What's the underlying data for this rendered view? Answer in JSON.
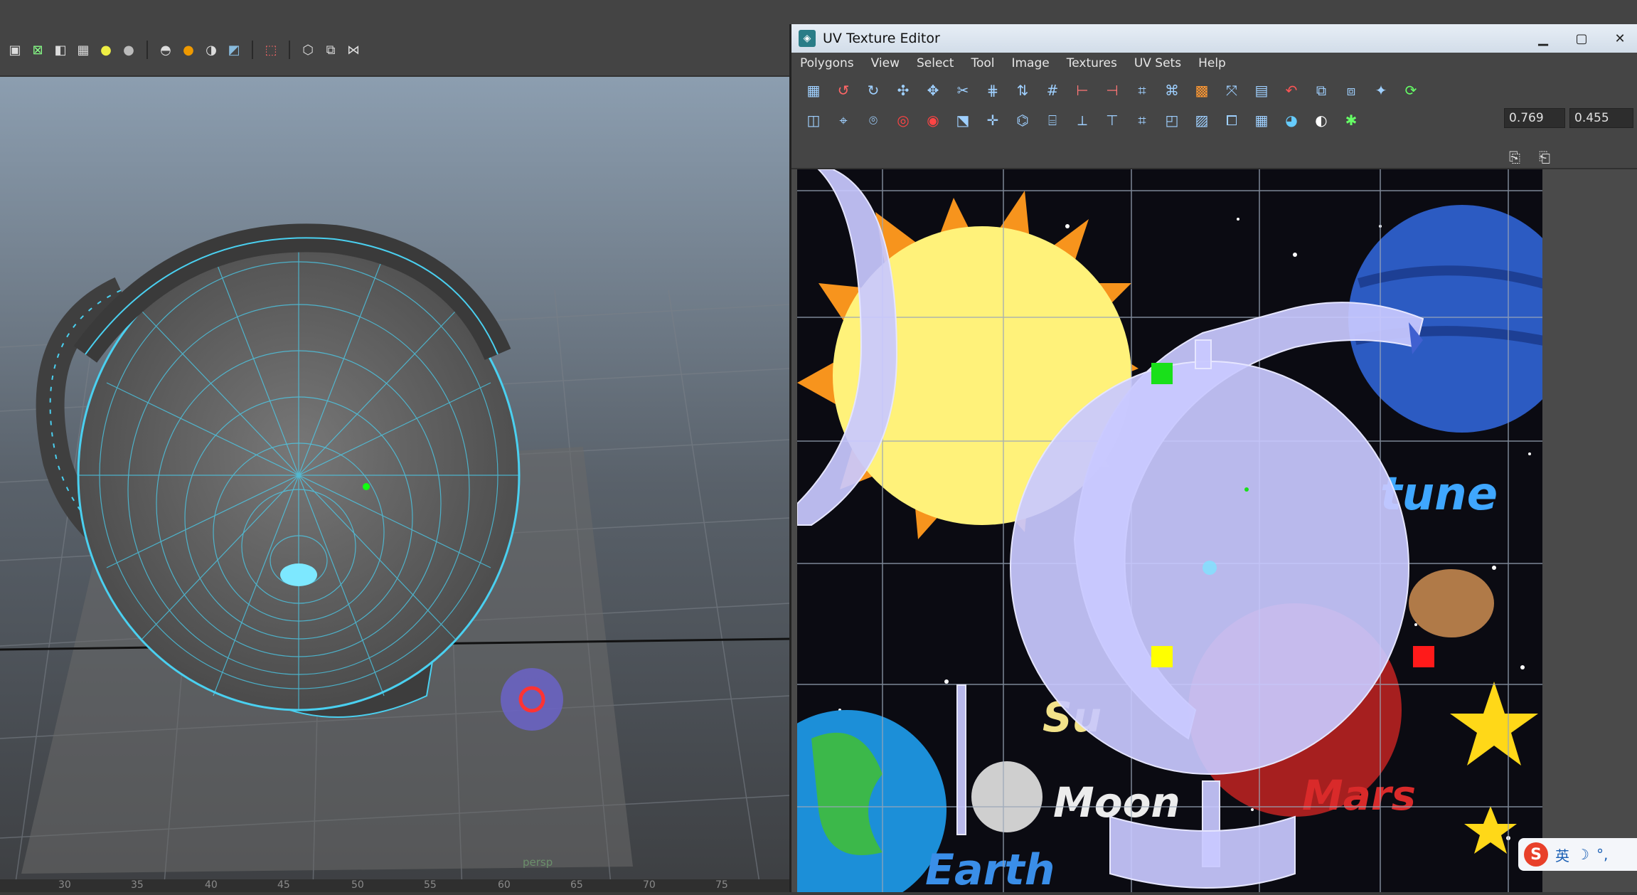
{
  "viewport": {
    "camera_label": "persp",
    "ruler_ticks": [
      "30",
      "35",
      "40",
      "45",
      "50",
      "55",
      "60",
      "65",
      "70",
      "75"
    ],
    "toolbar_icons": [
      "cube-icon",
      "wireframe-icon",
      "shaded-cube-icon",
      "checker-icon",
      "light-icon",
      "sphere-icon",
      "camera-icon",
      "material-icon",
      "contrast-icon",
      "texture-icon",
      "select-icon",
      "isolate-icon",
      "frame-icon",
      "graph-icon"
    ]
  },
  "uv_editor": {
    "title": "UV Texture Editor",
    "window_controls": {
      "minimize": "▁",
      "maximize": "▢",
      "close": "✕"
    },
    "menu": [
      "Polygons",
      "View",
      "Select",
      "Tool",
      "Image",
      "Textures",
      "UV Sets",
      "Help"
    ],
    "coord_u": "0.769",
    "coord_v": "0.455",
    "texture_labels": [
      "tune",
      "Moon",
      "Mars",
      "Earth",
      "Su"
    ]
  },
  "ime": {
    "logo": "S",
    "mode": "英",
    "moon": "☽",
    "punct": "°,"
  },
  "colors": {
    "uv_shell": "#c9c9ff",
    "grid": "#9aa6b8",
    "accent_green": "#19e01a",
    "accent_yellow": "#ffff00",
    "accent_red": "#ff1a1a"
  }
}
